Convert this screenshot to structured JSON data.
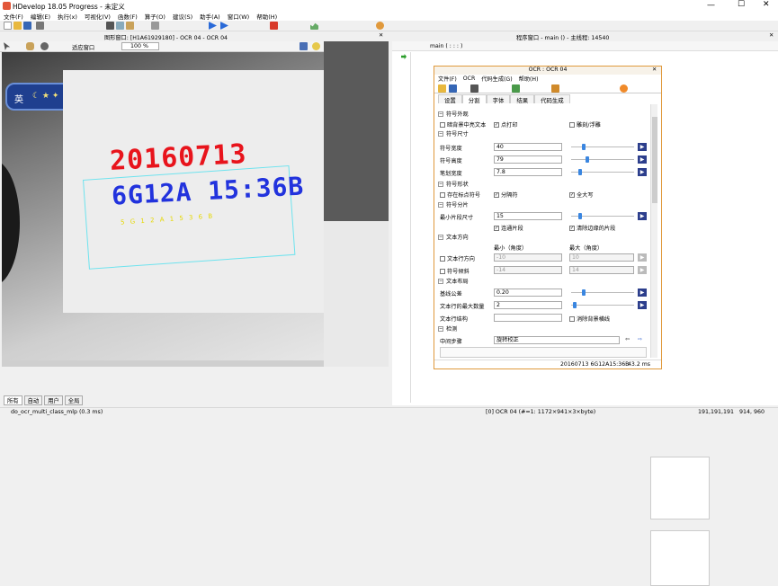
{
  "app": {
    "title": "HDevelop 18.05 Progress - 未定义"
  },
  "menu": [
    "文件(F)",
    "编辑(E)",
    "执行(x)",
    "可视化(V)",
    "函数(F)",
    "算子(O)",
    "建议(S)",
    "助手(A)",
    "窗口(W)",
    "帮助(H)"
  ],
  "graphics": {
    "title": "图形窗口: [H1A61929180] - OCR 04 - OCR 04",
    "fit_label": "适应窗口",
    "zoom": "100 %",
    "ime": "英"
  },
  "ocr_texts": {
    "line1": "20160713",
    "line2": "6G12A 15:36B",
    "result": "5 G 1 2 A   1 5   3 6 B"
  },
  "tabs": [
    "所有",
    "自动",
    "用户",
    "全局"
  ],
  "status": {
    "left": "do_ocr_multi_class_mlp (0.3 ms)",
    "mid": "[0] OCR 04 (#=1: 1172×941×3×byte)",
    "coords": "191,191,191",
    "pos": "914, 960"
  },
  "program": {
    "title": "程序窗口 - main () - 主线程: 14540",
    "proc": "main ( : : : )"
  },
  "ocr": {
    "title": "OCR : OCR 04",
    "menu": [
      "文件(F)",
      "OCR",
      "代码生成(G)",
      "帮助(H)"
    ],
    "tabs": [
      "设置",
      "分割",
      "字体",
      "结果",
      "代码生成"
    ],
    "active_tab": 1,
    "sections": {
      "appearance": "符号外观",
      "size": "符号尺寸",
      "shape": "符号形状",
      "split": "符号分片",
      "direction": "文本方向",
      "layout": "文本布局",
      "detect": "检测"
    },
    "labels": {
      "dark_text": "暗背景中亮文本",
      "dot_print": "点打印",
      "engrave": "雕刻/浮雕",
      "width": "符号宽度",
      "height": "符号高度",
      "stroke": "笔划宽度",
      "punct": "存在标点符号",
      "sep": "分隔符",
      "upper": "全大写",
      "min_frag": "最小片段尺寸",
      "connect": "连通片段",
      "clean": "清除边缘的片段",
      "min_angle": "最小（角度）",
      "max_angle": "最大（角度）",
      "line_dir": "文本行方向",
      "slant": "符号倾斜",
      "baseline": "基线公差",
      "max_lines": "文本行的最大数量",
      "line_struct": "文本行结构",
      "rm_bg": "消除背景横线",
      "step": "中间步骤"
    },
    "values": {
      "width": "40",
      "height": "79",
      "stroke": "7.8",
      "min_frag": "15",
      "dir_min": "-10",
      "dir_max": "10",
      "slant_min": "-14",
      "slant_max": "14",
      "baseline": "0.20",
      "max_lines": "2",
      "line_struct": "",
      "step": "旋转校正"
    },
    "status": {
      "result": "20160713 6G12A15:36B",
      "time": "43.2 ms"
    }
  },
  "colors": {
    "accent": "#e0993c",
    "roi": "#6ee3ee",
    "char_red": "#e8141c",
    "char_blue": "#2233dd",
    "char_green": "#33cc22",
    "char_yellow": "#e6d800"
  }
}
